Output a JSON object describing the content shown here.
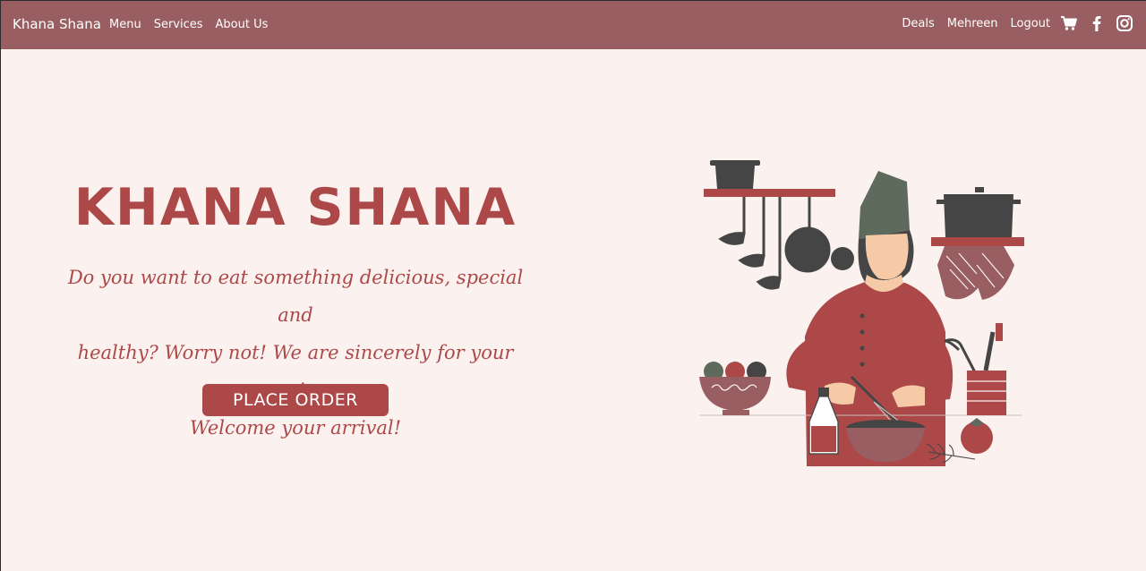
{
  "navbar": {
    "brand": "Khana Shana",
    "left_links": [
      "Menu",
      "Services",
      "About Us"
    ],
    "right_links": [
      "Deals",
      "Mehreen",
      "Logout"
    ],
    "icons": [
      "cart-icon",
      "facebook-icon",
      "instagram-icon"
    ]
  },
  "hero": {
    "title": "KHANA SHANA",
    "text_line1": "Do you want to eat something delicious, special and",
    "text_line2": "healthy? Worry not! We are sincerely for your service.",
    "text_line3": "Welcome your arrival!",
    "cta_label": "PLACE ORDER"
  },
  "colors": {
    "navbar_bg": "#985e61",
    "accent": "#ad4848",
    "page_bg": "#fbf2f0",
    "dark_gray": "#454545"
  }
}
